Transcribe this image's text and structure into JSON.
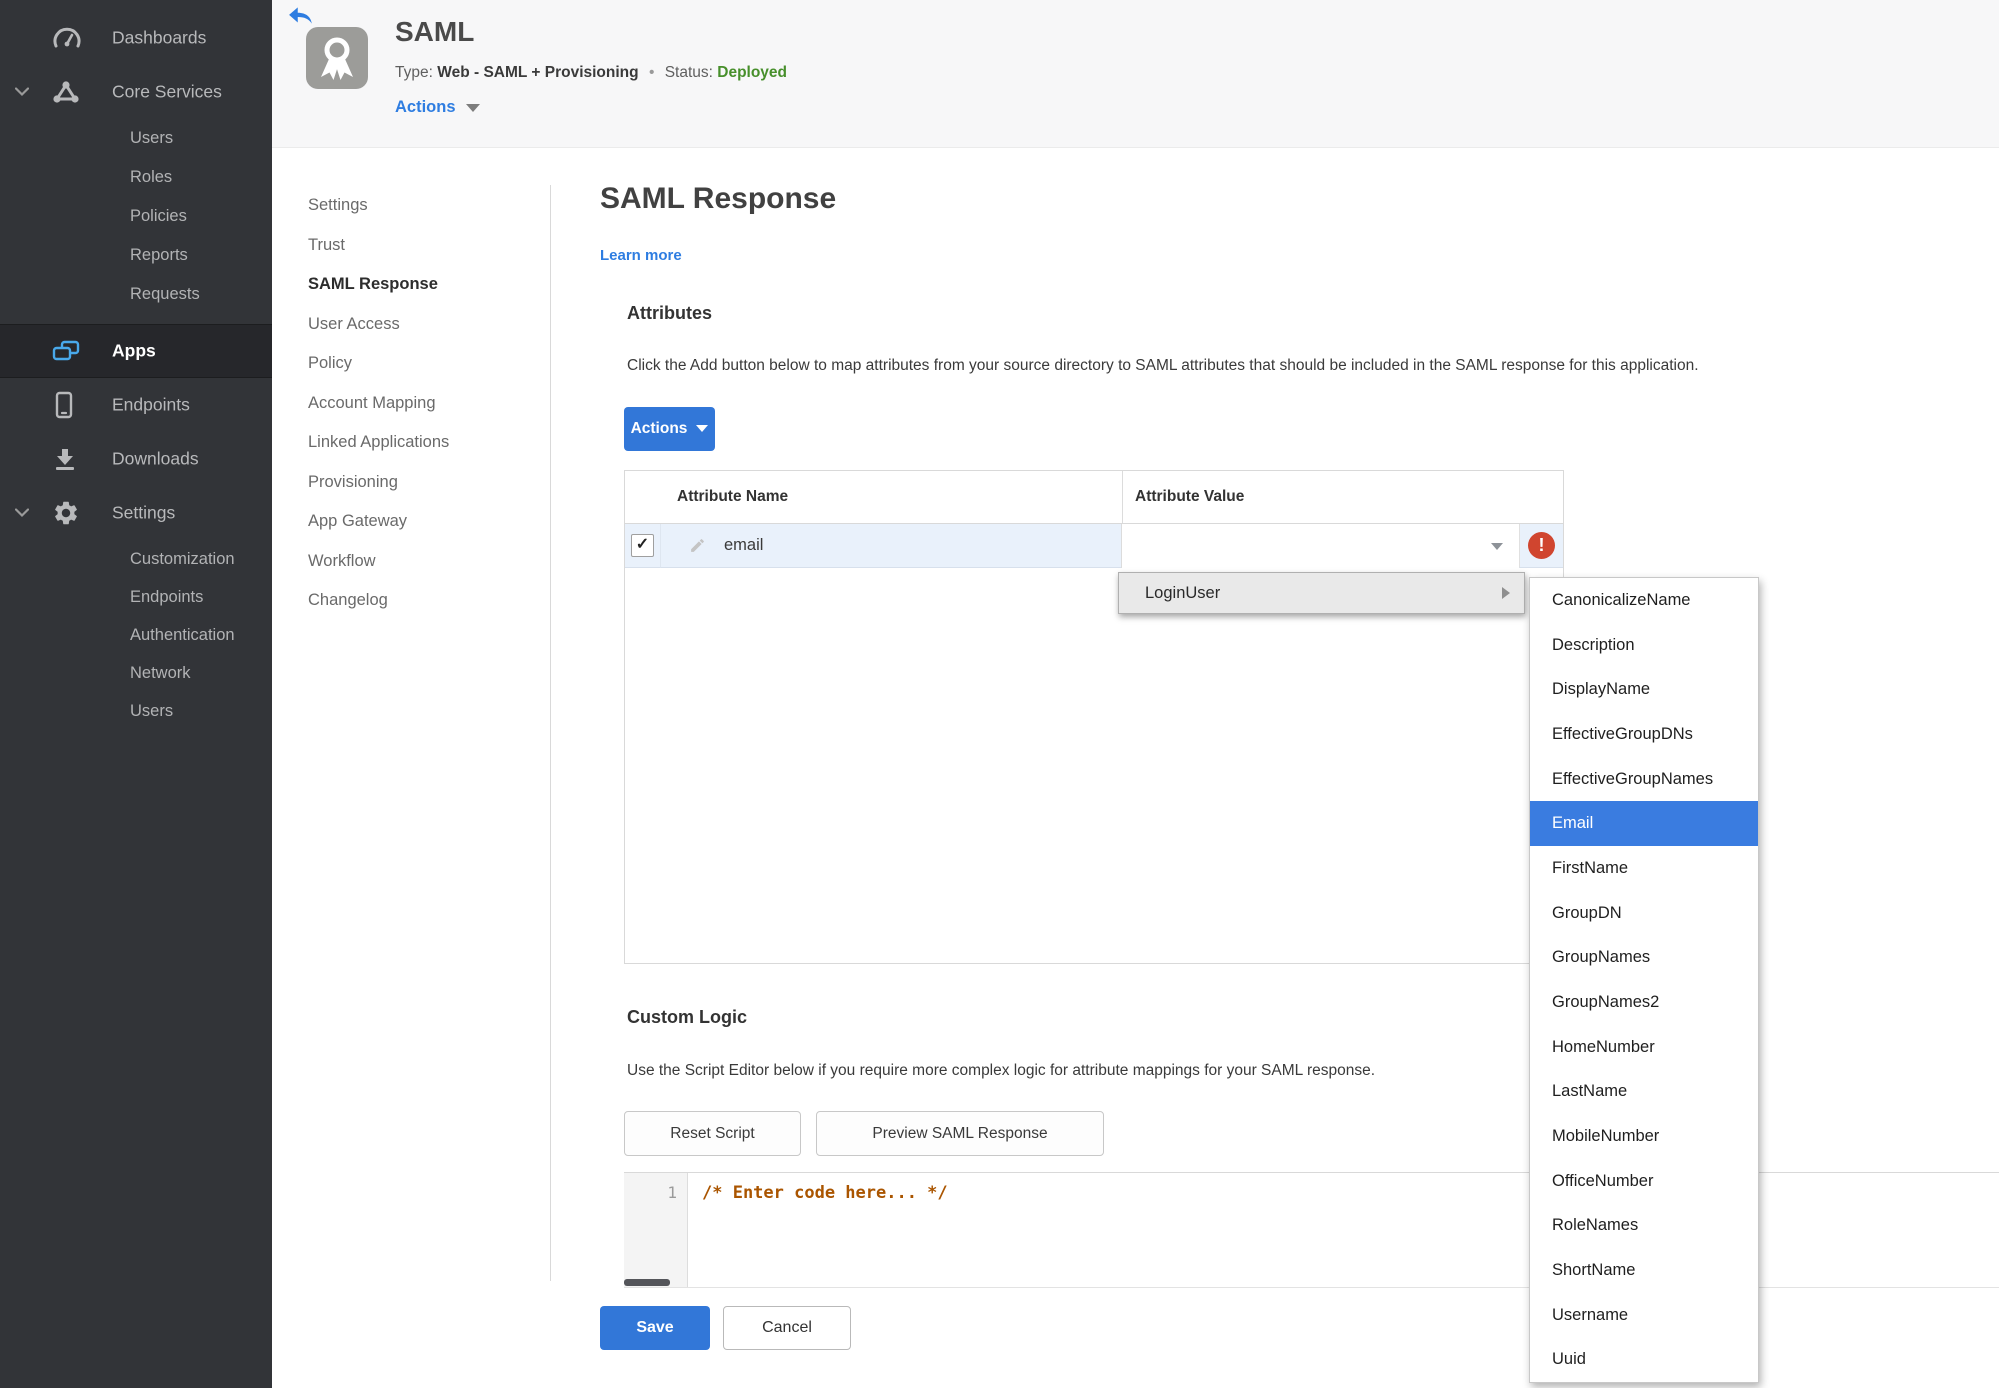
{
  "colors": {
    "accent_blue": "#3277d8",
    "link_blue": "#2e7de1",
    "status_green": "#478f2b",
    "error_red": "#d0452f",
    "selected_blue": "#3a7ce0",
    "sidebar_bg": "#323438",
    "sidebar_active_icon_blue": "#49a9eb",
    "row_highlight": "#e9f1fb",
    "code_comment": "#aa5500"
  },
  "glyphs": {
    "check": "✓",
    "error": "!"
  },
  "sidebar": {
    "dashboards": "Dashboards",
    "core_services": "Core Services",
    "core_children": [
      "Users",
      "Roles",
      "Policies",
      "Reports",
      "Requests"
    ],
    "apps": "Apps",
    "endpoints": "Endpoints",
    "downloads": "Downloads",
    "settings": "Settings",
    "settings_children": [
      "Customization",
      "Endpoints",
      "Authentication",
      "Network",
      "Users"
    ]
  },
  "header": {
    "title": "SAML",
    "type_label": "Type:",
    "type_value": "Web - SAML + Provisioning",
    "dot": "•",
    "status_label": "Status:",
    "status_value": "Deployed",
    "actions_label": "Actions"
  },
  "subnav": {
    "items": [
      {
        "label": "Settings"
      },
      {
        "label": "Trust"
      },
      {
        "label": "SAML Response"
      },
      {
        "label": "User Access"
      },
      {
        "label": "Policy"
      },
      {
        "label": "Account Mapping"
      },
      {
        "label": "Linked Applications"
      },
      {
        "label": "Provisioning"
      },
      {
        "label": "App Gateway"
      },
      {
        "label": "Workflow"
      },
      {
        "label": "Changelog"
      }
    ]
  },
  "main": {
    "title": "SAML Response",
    "learn_more": "Learn more",
    "attributes_heading": "Attributes",
    "attributes_description": "Click the Add button below to map attributes from your source directory to SAML attributes that should be included in the SAML response for this application.",
    "actions_button": "Actions",
    "table": {
      "col_name": "Attribute Name",
      "col_value": "Attribute Value",
      "row": {
        "name": "email",
        "value": ""
      }
    },
    "custom_logic_heading": "Custom Logic",
    "custom_logic_description": "Use the Script Editor below if you require more complex logic for attribute mappings for your SAML response.",
    "reset_button": "Reset Script",
    "preview_button": "Preview SAML Response",
    "editor": {
      "line_number": "1",
      "code": "/* Enter code here... */"
    },
    "save_button": "Save",
    "cancel_button": "Cancel"
  },
  "menu": {
    "parent": "LoginUser",
    "selected": "Email",
    "items": [
      "CanonicalizeName",
      "Description",
      "DisplayName",
      "EffectiveGroupDNs",
      "EffectiveGroupNames",
      "Email",
      "FirstName",
      "GroupDN",
      "GroupNames",
      "GroupNames2",
      "HomeNumber",
      "LastName",
      "MobileNumber",
      "OfficeNumber",
      "RoleNames",
      "ShortName",
      "Username",
      "Uuid"
    ]
  }
}
